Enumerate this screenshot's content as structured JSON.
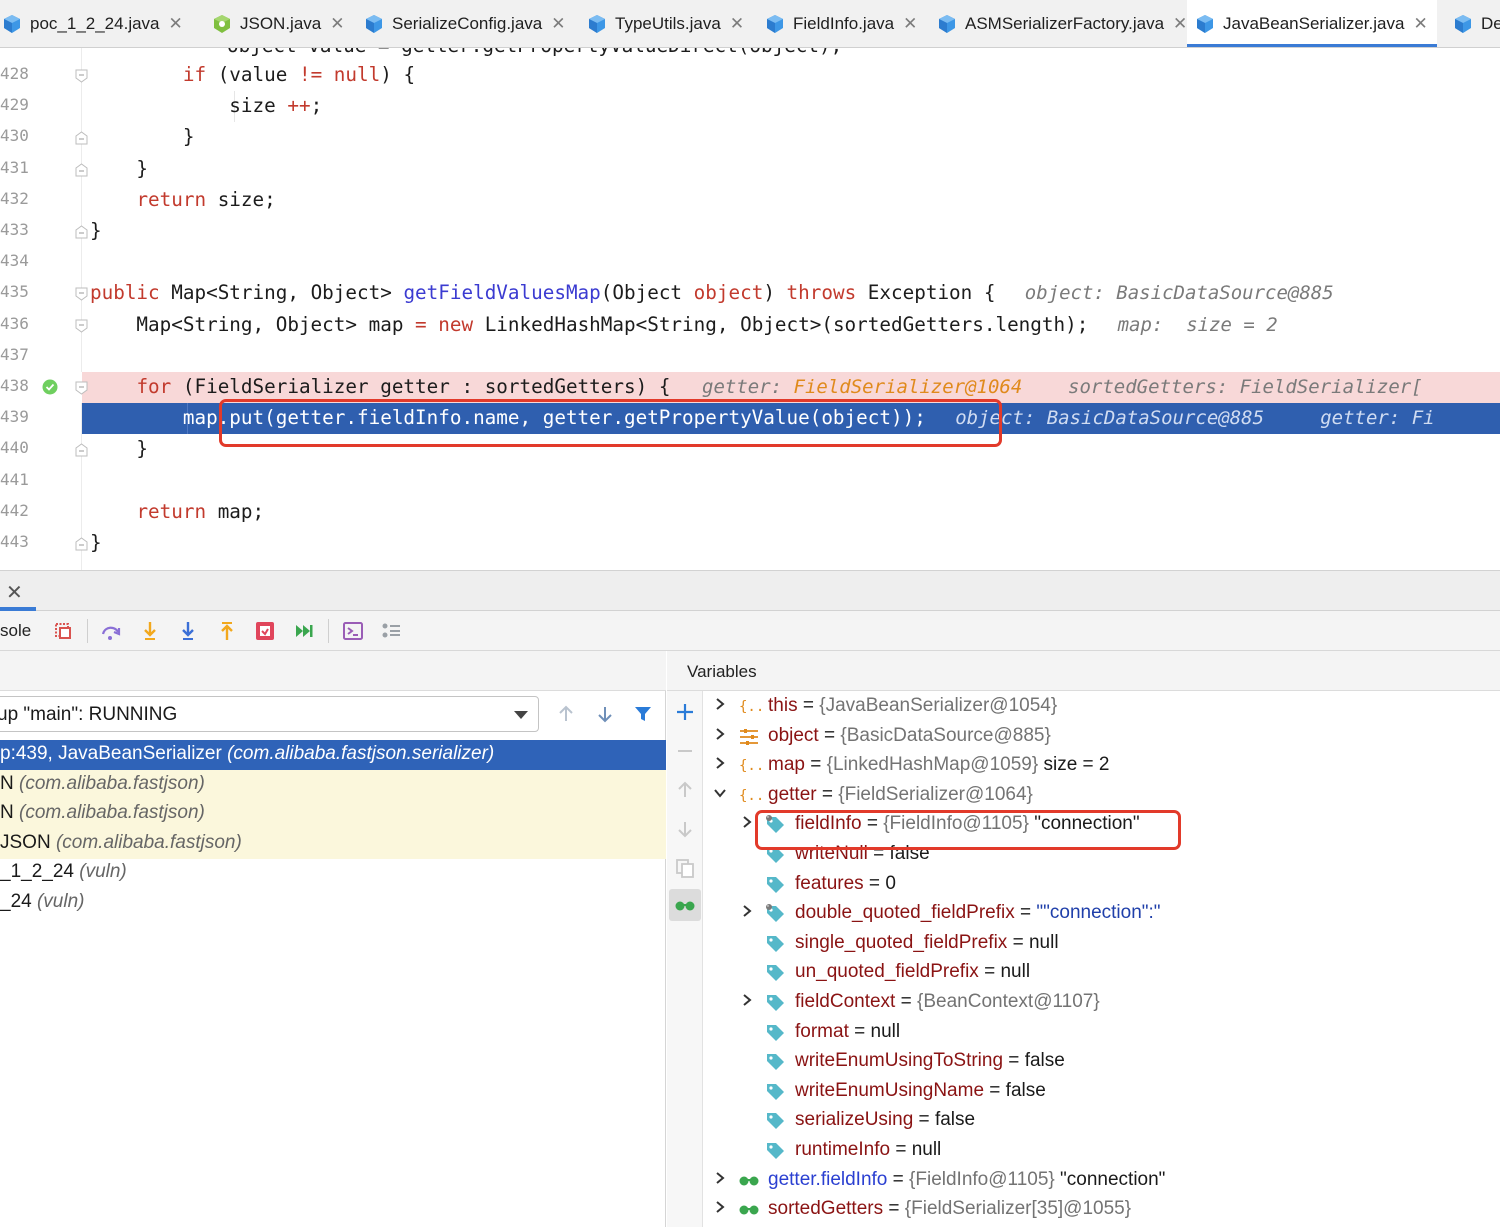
{
  "tabs": [
    {
      "label": "poc_1_2_24.java",
      "icon": "java-class-icon",
      "active": false
    },
    {
      "label": "JSON.java",
      "icon": "java-abstract-class-icon",
      "active": false
    },
    {
      "label": "SerializeConfig.java",
      "icon": "java-class-icon",
      "active": false
    },
    {
      "label": "TypeUtils.java",
      "icon": "java-class-icon",
      "active": false
    },
    {
      "label": "FieldInfo.java",
      "icon": "java-class-icon",
      "active": false
    },
    {
      "label": "ASMSerializerFactory.java",
      "icon": "java-class-icon",
      "active": false
    },
    {
      "label": "JavaBeanSerializer.java",
      "icon": "java-class-icon",
      "active": true
    },
    {
      "label": "Def",
      "icon": "java-class-icon",
      "active": false
    }
  ],
  "editor": {
    "lines": [
      {
        "num": "428",
        "code": "        if (value != null) {"
      },
      {
        "num": "429",
        "code": "            size ++;"
      },
      {
        "num": "430",
        "code": "        }"
      },
      {
        "num": "431",
        "code": "    }"
      },
      {
        "num": "432",
        "code": "    return size;"
      },
      {
        "num": "433",
        "code": "}"
      },
      {
        "num": "434",
        "code": ""
      },
      {
        "num": "435",
        "code": "public Map<String, Object> getFieldValuesMap(Object object) throws Exception {",
        "hint": "object: BasicDataSource@885"
      },
      {
        "num": "436",
        "code": "    Map<String, Object> map = new LinkedHashMap<String, Object>(sortedGetters.length);",
        "hint": "map:  size = 2"
      },
      {
        "num": "437",
        "code": ""
      },
      {
        "num": "438",
        "code": "    for (FieldSerializer getter : sortedGetters) {",
        "hint_getter_label": "getter: ",
        "hint_getter_value": "FieldSerializer@1064",
        "hint2": "sortedGetters: FieldSerializer["
      },
      {
        "num": "439",
        "code": "        map.put(getter.fieldInfo.name, getter.getPropertyValue(object));",
        "hint": "object: BasicDataSource@885",
        "hint2": "getter: Fi"
      },
      {
        "num": "440",
        "code": "    }"
      },
      {
        "num": "441",
        "code": ""
      },
      {
        "num": "442",
        "code": "    return map;"
      },
      {
        "num": "443",
        "code": "}"
      }
    ],
    "clipped_top_line": "object value = getter.getPropertyValueDirect(object);"
  },
  "debug": {
    "console_label": "sole",
    "thread": "up \"main\": RUNNING",
    "frames": [
      {
        "method": "p:439, JavaBeanSerializer ",
        "pkg": "(com.alibaba.fastjson.serializer)",
        "selected": true
      },
      {
        "method": "N ",
        "pkg": "(com.alibaba.fastjson)",
        "selected": false
      },
      {
        "method": "N ",
        "pkg": "(com.alibaba.fastjson)",
        "selected": false
      },
      {
        "method": "JSON ",
        "pkg": "(com.alibaba.fastjson)",
        "selected": false
      },
      {
        "method": "_1_2_24 ",
        "pkg": "(vuln)",
        "selected": false
      },
      {
        "method": "_24 ",
        "pkg": "(vuln)",
        "selected": false
      }
    ],
    "variables_title": "Variables",
    "variables": [
      {
        "name": "this",
        "value": "{JavaBeanSerializer@1054}",
        "extra": "",
        "icon": "object-icon",
        "arrow": "right",
        "indent": 0
      },
      {
        "name": "object",
        "value": "{BasicDataSource@885}",
        "extra": "",
        "icon": "object-fields-icon",
        "arrow": "right",
        "indent": 0
      },
      {
        "name": "map",
        "value": "{LinkedHashMap@1059}",
        "extra": " size = 2",
        "icon": "object-icon",
        "arrow": "right",
        "indent": 0
      },
      {
        "name": "getter",
        "value": "{FieldSerializer@1064}",
        "extra": "",
        "icon": "object-icon",
        "arrow": "down",
        "indent": 0
      },
      {
        "name": "fieldInfo",
        "value": "{FieldInfo@1105}",
        "extra": " \"connection\"",
        "icon": "field-final-icon",
        "arrow": "right",
        "indent": 1
      },
      {
        "name": "writeNull",
        "value": "false",
        "extra": "",
        "icon": "field-icon",
        "arrow": "",
        "indent": 1
      },
      {
        "name": "features",
        "value": "0",
        "extra": "",
        "icon": "field-icon",
        "arrow": "",
        "indent": 1
      },
      {
        "name": "double_quoted_fieldPrefix",
        "value": "\"\"connection\":\"",
        "extra": "",
        "icon": "field-final-icon",
        "arrow": "right",
        "indent": 1
      },
      {
        "name": "single_quoted_fieldPrefix",
        "value": "null",
        "extra": "",
        "icon": "field-icon",
        "arrow": "",
        "indent": 1
      },
      {
        "name": "un_quoted_fieldPrefix",
        "value": "null",
        "extra": "",
        "icon": "field-icon",
        "arrow": "",
        "indent": 1
      },
      {
        "name": "fieldContext",
        "value": "{BeanContext@1107}",
        "extra": "",
        "icon": "field-icon",
        "arrow": "right",
        "indent": 1
      },
      {
        "name": "format",
        "value": "null",
        "extra": "",
        "icon": "field-icon",
        "arrow": "",
        "indent": 1
      },
      {
        "name": "writeEnumUsingToString",
        "value": "false",
        "extra": "",
        "icon": "field-icon",
        "arrow": "",
        "indent": 1
      },
      {
        "name": "writeEnumUsingName",
        "value": "false",
        "extra": "",
        "icon": "field-icon",
        "arrow": "",
        "indent": 1
      },
      {
        "name": "serializeUsing",
        "value": "false",
        "extra": "",
        "icon": "field-icon",
        "arrow": "",
        "indent": 1
      },
      {
        "name": "runtimeInfo",
        "value": "null",
        "extra": "",
        "icon": "field-icon",
        "arrow": "",
        "indent": 1
      },
      {
        "name": "getter.fieldInfo",
        "value": "{FieldInfo@1105}",
        "extra": " \"connection\"",
        "icon": "watch-icon",
        "arrow": "right",
        "indent": 0
      },
      {
        "name": "sortedGetters",
        "value": "{FieldSerializer[35]@1055}",
        "extra": "",
        "icon": "watch-icon",
        "arrow": "right",
        "indent": 0
      }
    ]
  },
  "colors": {
    "keyword": "#c23a2d",
    "method": "#3b3bd1",
    "execution_line": "#2f5faf",
    "breakpoint_line": "#f8d8d8",
    "annotation_box": "#e23a2a",
    "selected_frame": "#2f63b8",
    "library_frame": "#fbf7dc"
  }
}
